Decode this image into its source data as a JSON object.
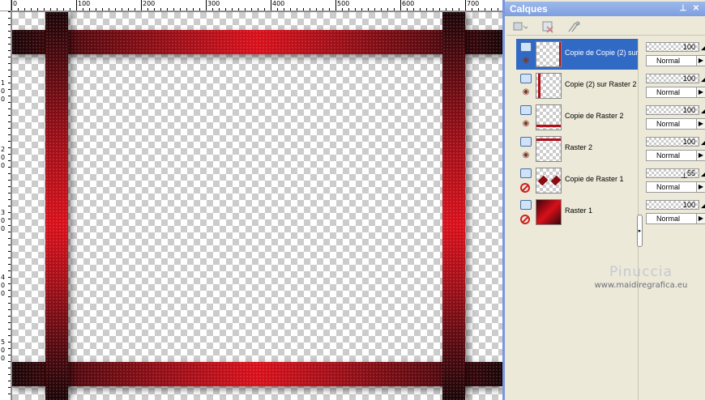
{
  "panel": {
    "title": "Calques",
    "pin_glyph": "⊥",
    "close_glyph": "✕"
  },
  "toolbar": {
    "icons": [
      "new-layer-icon",
      "delete-layer-icon",
      "mask-icon"
    ]
  },
  "rulers": {
    "top_labels": [
      "0",
      "100",
      "200",
      "300",
      "400",
      "500",
      "600",
      "700"
    ],
    "left_labels": [
      "1",
      "0",
      "0",
      "2",
      "0",
      "0",
      "3",
      "0",
      "0",
      "4",
      "0",
      "0",
      "5",
      "0",
      "0"
    ]
  },
  "layers": [
    {
      "name": "Copie de Copie (2) sur",
      "visible": true,
      "selected": true,
      "opacity": "100",
      "blend": "Normal"
    },
    {
      "name": "Copie (2) sur Raster 2",
      "visible": true,
      "selected": false,
      "opacity": "100",
      "blend": "Normal"
    },
    {
      "name": "Copie de Raster 2",
      "visible": true,
      "selected": false,
      "opacity": "100",
      "blend": "Normal"
    },
    {
      "name": "Raster 2",
      "visible": true,
      "selected": false,
      "opacity": "100",
      "blend": "Normal"
    },
    {
      "name": "Copie de Raster 1",
      "visible": false,
      "selected": false,
      "opacity": "55",
      "blend": "Normal"
    },
    {
      "name": "Raster 1",
      "visible": false,
      "selected": false,
      "opacity": "100",
      "blend": "Normal"
    }
  ],
  "watermark": {
    "name": "Pinuccia",
    "url": "www.maidiregrafica.eu"
  },
  "colors": {
    "frame_red": "#d8101b",
    "frame_dark": "#1a0507",
    "selection_blue": "#316ac5",
    "panel_title": "#7e9ee0"
  }
}
